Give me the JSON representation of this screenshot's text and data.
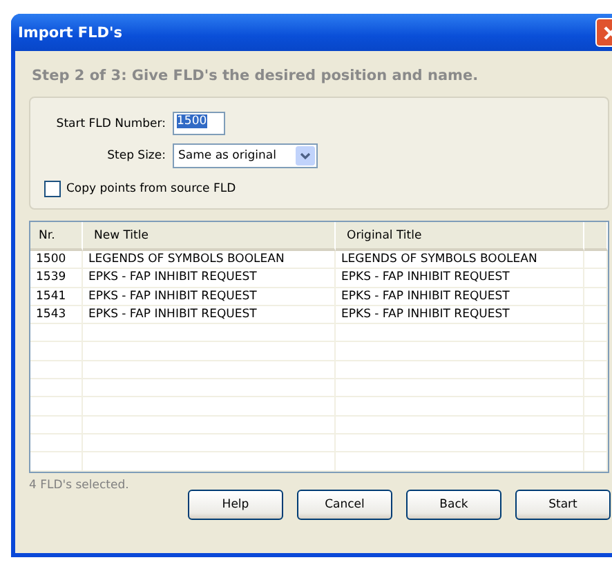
{
  "window": {
    "title": "Import FLD's"
  },
  "heading": "Step 2 of 3: Give FLD's the desired position and name.",
  "start_field": {
    "label": "Start FLD Number:",
    "value": "1500"
  },
  "step_field": {
    "label": "Step Size:",
    "value": "Same as original"
  },
  "copy_checkbox": {
    "label": "Copy points from source FLD",
    "checked": false
  },
  "table": {
    "columns": [
      "Nr.",
      "New Title",
      "Original Title"
    ],
    "rows": [
      {
        "nr": "1500",
        "new_title": "LEGENDS OF SYMBOLS BOOLEAN",
        "original_title": "LEGENDS OF SYMBOLS BOOLEAN"
      },
      {
        "nr": "1539",
        "new_title": "EPKS - FAP INHIBIT REQUEST",
        "original_title": "EPKS - FAP INHIBIT REQUEST"
      },
      {
        "nr": "1541",
        "new_title": "EPKS - FAP INHIBIT REQUEST",
        "original_title": "EPKS - FAP INHIBIT REQUEST"
      },
      {
        "nr": "1543",
        "new_title": "EPKS - FAP INHIBIT REQUEST",
        "original_title": "EPKS - FAP INHIBIT REQUEST"
      }
    ]
  },
  "status": "4 FLD's selected.",
  "buttons": [
    "Help",
    "Cancel",
    "Back",
    "Start"
  ]
}
